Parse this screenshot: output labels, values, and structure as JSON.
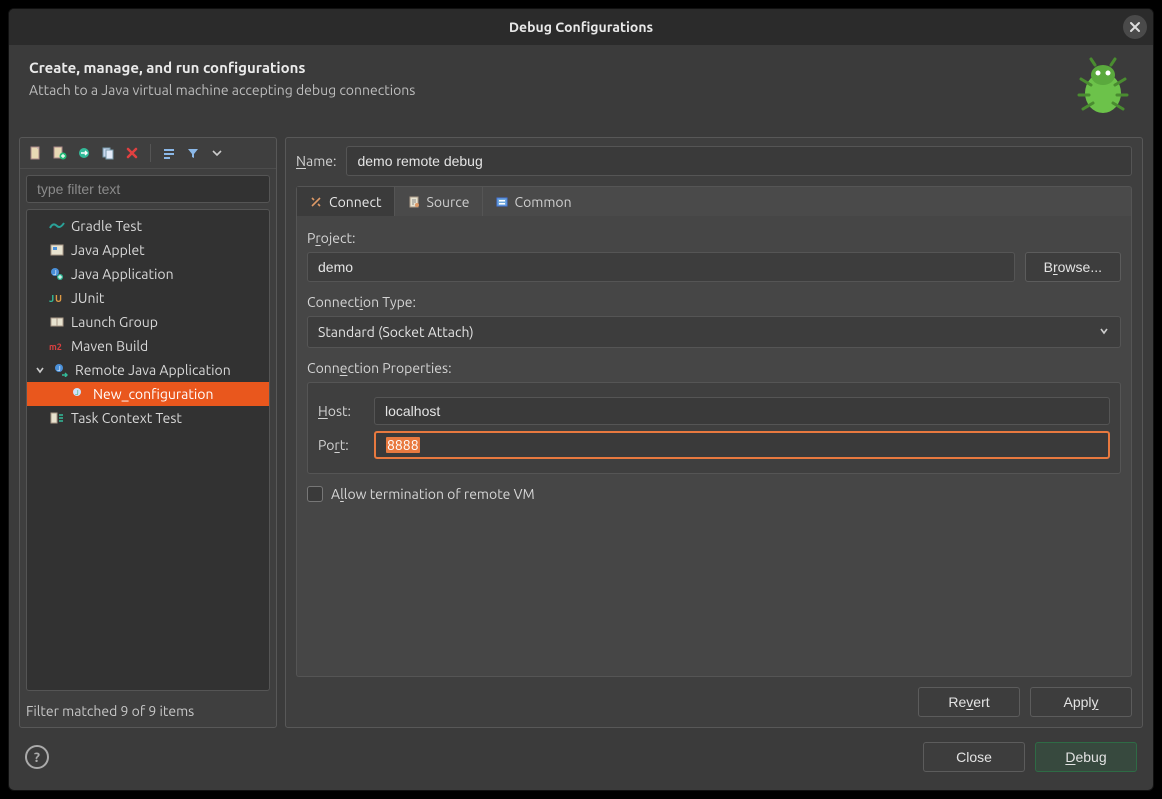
{
  "window": {
    "title": "Debug Configurations"
  },
  "header": {
    "heading": "Create, manage, and run configurations",
    "sub": "Attach to a Java virtual machine accepting debug connections"
  },
  "filter": {
    "placeholder": "type filter text",
    "status": "Filter matched 9 of 9 items"
  },
  "tree": {
    "items": [
      {
        "label": "Gradle Test",
        "icon": "gradle"
      },
      {
        "label": "Java Applet",
        "icon": "applet"
      },
      {
        "label": "Java Application",
        "icon": "java-app"
      },
      {
        "label": "JUnit",
        "icon": "junit"
      },
      {
        "label": "Launch Group",
        "icon": "launch-group"
      },
      {
        "label": "Maven Build",
        "icon": "maven"
      },
      {
        "label": "Remote Java Application",
        "icon": "remote-java",
        "expanded": true,
        "children": [
          {
            "label": "New_configuration",
            "selected": true
          }
        ]
      },
      {
        "label": "Task Context Test",
        "icon": "task-context"
      }
    ]
  },
  "form": {
    "name_label_pre": "N",
    "name_label_post": "ame:",
    "name_value": "demo remote debug",
    "tabs": {
      "connect": "Connect",
      "source": "Source",
      "common": "Common"
    },
    "project": {
      "label_pre": "P",
      "label_u": "r",
      "label_post": "oject:",
      "value": "demo",
      "browse_pre": "B",
      "browse_u": "r",
      "browse_post": "owse..."
    },
    "conn_type": {
      "label_pre": "Connect",
      "label_u": "i",
      "label_post": "on Type:",
      "value": "Standard (Socket Attach)"
    },
    "conn_props": {
      "label_pre": "Conn",
      "label_u": "e",
      "label_post": "ction Properties:",
      "host_label_u": "H",
      "host_label_post": "ost:",
      "host_value": "localhost",
      "port_label_pre": "Po",
      "port_label_u": "r",
      "port_label_post": "t:",
      "port_value": "8888"
    },
    "allow_term_pre": "A",
    "allow_term_u": "l",
    "allow_term_post": "low termination of remote VM",
    "revert_pre": "Re",
    "revert_u": "v",
    "revert_post": "ert",
    "apply_pre": "Appl",
    "apply_u": "y",
    "apply_post": ""
  },
  "footer": {
    "close": "Close",
    "debug_u": "D",
    "debug_post": "ebug"
  }
}
